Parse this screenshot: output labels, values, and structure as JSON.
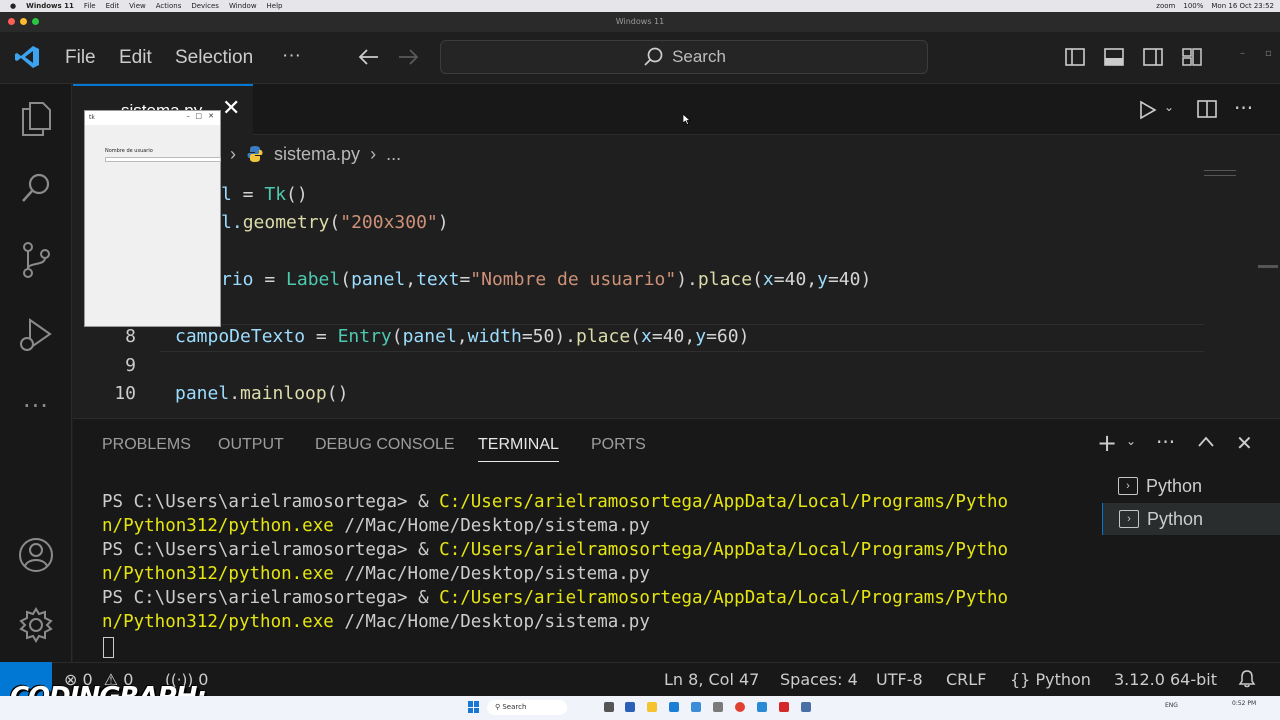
{
  "mac_menubar": {
    "app": "Windows 11",
    "items": [
      "File",
      "Edit",
      "View",
      "Actions",
      "Devices",
      "Window",
      "Help"
    ],
    "zoom_label": "zoom",
    "battery": "100%",
    "clock": "Mon 16 Oct 23:52"
  },
  "window_title": "Windows 11",
  "menu": {
    "file": "File",
    "edit": "Edit",
    "selection": "Selection",
    "more": "···"
  },
  "search": {
    "label": "Search"
  },
  "tab": {
    "filename": "sistema.py"
  },
  "breadcrumb": {
    "folder": "op",
    "file": "sistema.py",
    "more": "..."
  },
  "code_lines": [
    {
      "num": "",
      "text": "l = Tk()"
    },
    {
      "num": "",
      "text": "l.geometry(\"200x300\")"
    },
    {
      "num": "",
      "text": ""
    },
    {
      "num": "",
      "text": "rio = Label(panel,text=\"Nombre de usuario\").place(x=40,y=40)"
    },
    {
      "num": "",
      "text": ""
    },
    {
      "num": "8",
      "text": "campoDeTexto = Entry(panel,width=50).place(x=40,y=60)"
    },
    {
      "num": "9",
      "text": ""
    },
    {
      "num": "10",
      "text": "panel.mainloop()"
    }
  ],
  "code_tokens": {
    "l1_a": "l",
    "l1_b": " = ",
    "l1_c": "Tk",
    "l1_d": "()",
    "l2_a": "l.",
    "l2_b": "geometry",
    "l2_c": "(",
    "l2_d": "\"200x300\"",
    "l2_e": ")",
    "l4_a": "rio",
    "l4_b": " = ",
    "l4_c": "Label",
    "l4_d": "(",
    "l4_e": "panel",
    "l4_f": ",",
    "l4_g": "text",
    "l4_h": "=",
    "l4_i": "\"Nombre de usuario\"",
    "l4_j": ").",
    "l4_k": "place",
    "l4_l": "(",
    "l4_m": "x",
    "l4_n": "=40,",
    "l4_o": "y",
    "l4_p": "=40)",
    "l8_a": "campoDeTexto",
    "l8_b": " = ",
    "l8_c": "Entry",
    "l8_d": "(",
    "l8_e": "panel",
    "l8_f": ",",
    "l8_g": "width",
    "l8_h": "=50).",
    "l8_i": "place",
    "l8_j": "(",
    "l8_k": "x",
    "l8_l": "=40,",
    "l8_m": "y",
    "l8_n": "=60)",
    "l10_a": "panel",
    "l10_b": ".",
    "l10_c": "mainloop",
    "l10_d": "()"
  },
  "panel_tabs": {
    "problems": "PROBLEMS",
    "output": "OUTPUT",
    "debug": "DEBUG CONSOLE",
    "terminal": "TERMINAL",
    "ports": "PORTS"
  },
  "terminal": {
    "prompt": "PS C:\\Users\\arielramosortega> ",
    "amp": "& ",
    "path1": "C:/Users/arielramosortega/AppData/Local/Programs/Pytho",
    "path2": "n/Python312/python.exe",
    "arg": " //Mac/Home/Desktop/sistema.py"
  },
  "terminal_list": [
    "Python",
    "Python"
  ],
  "status": {
    "errors": "0",
    "warnings": "0",
    "ports": "0",
    "position": "Ln 8, Col 47",
    "spaces": "Spaces: 4",
    "encoding": "UTF-8",
    "eol": "CRLF",
    "language": "Python",
    "interpreter": "3.12.0 64-bit"
  },
  "tk_window": {
    "label": "Nombre de usuario",
    "title": "tk"
  },
  "taskbar": {
    "search": "Search",
    "lang": "ENG",
    "clock": "0:52 PM"
  },
  "watermark": "CODINGRAPH;",
  "colors": {
    "accent": "#0078d4",
    "editor_bg": "#1f1f1f",
    "sidebar_bg": "#181818"
  }
}
